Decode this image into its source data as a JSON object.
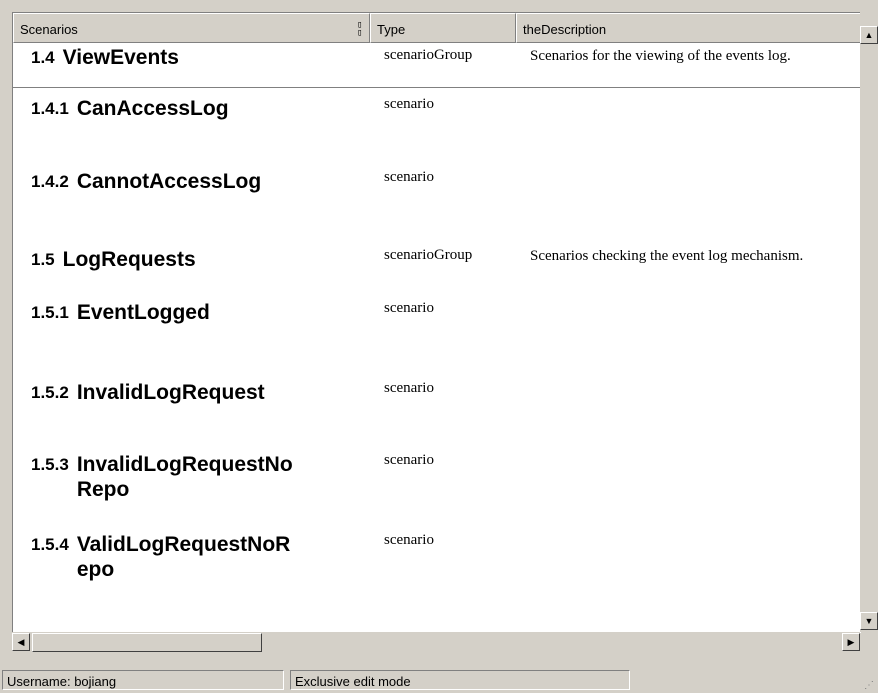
{
  "columns": {
    "scenarios": "Scenarios",
    "type": "Type",
    "description": "theDescription"
  },
  "rows": [
    {
      "num": "1.4",
      "title": "ViewEvents",
      "type": "scenarioGroup",
      "description": "Scenarios for the viewing of the events log."
    },
    {
      "num": "1.4.1",
      "title": "CanAccessLog",
      "type": "scenario",
      "description": ""
    },
    {
      "num": "1.4.2",
      "title": "CannotAccessLog",
      "type": "scenario",
      "description": ""
    },
    {
      "num": "1.5",
      "title": "LogRequests",
      "type": "scenarioGroup",
      "description": "Scenarios checking the event log mechanism."
    },
    {
      "num": "1.5.1",
      "title": "EventLogged",
      "type": "scenario",
      "description": ""
    },
    {
      "num": "1.5.2",
      "title": "InvalidLogRequest",
      "type": "scenario",
      "description": ""
    },
    {
      "num": "1.5.3",
      "title": "InvalidLogRequestNo Repo",
      "type": "scenario",
      "description": ""
    },
    {
      "num": "1.5.4",
      "title": "ValidLogRequestNoR epo",
      "type": "scenario",
      "description": ""
    }
  ],
  "status": {
    "username": "Username: bojiang",
    "mode": "Exclusive edit mode"
  },
  "icons": {
    "sort": "column-sort-icon",
    "scroll_up": "scroll-up-icon",
    "scroll_down": "scroll-down-icon",
    "scroll_left": "scroll-left-icon",
    "scroll_right": "scroll-right-icon",
    "resize": "resize-grip-icon"
  }
}
